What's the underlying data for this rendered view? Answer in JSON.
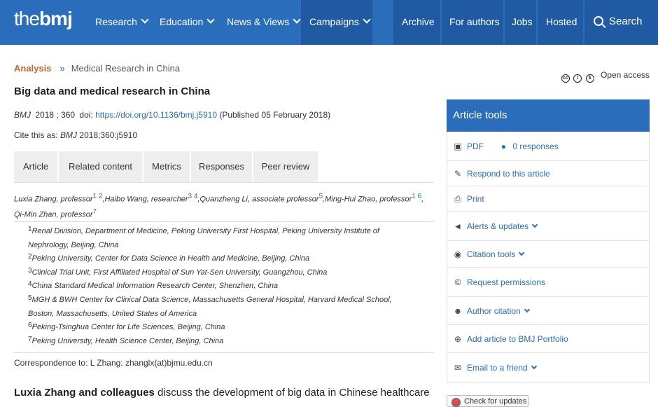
{
  "logo": {
    "the": "the",
    "bmj": "bmj"
  },
  "nav": {
    "research": "Research",
    "education": "Education",
    "news": "News & Views",
    "campaigns": "Campaigns",
    "archive": "Archive",
    "for_authors": "For authors",
    "jobs": "Jobs",
    "hosted": "Hosted",
    "search": "Search"
  },
  "breadcrumb": {
    "section": "Analysis",
    "separator": "»",
    "subsection": "Medical Research in China"
  },
  "open_access": "Open access",
  "article": {
    "title": "Big data and medical research in China",
    "journal": "BMJ",
    "year_vol": "2018 ; 360",
    "doi_label": "doi:",
    "doi": "https://doi.org/10.1136/bmj.j5910",
    "published": "(Published 05 February 2018)",
    "cite_prefix": "Cite this as:",
    "cite_journal": "BMJ",
    "cite_ref": "2018;360:j5910"
  },
  "tabs": [
    "Article",
    "Related content",
    "Metrics",
    "Responses",
    "Peer review"
  ],
  "authors": [
    {
      "name": "Luxia Zhang, professor",
      "sup": "1 2"
    },
    {
      "name": "Haibo Wang, researcher",
      "sup": "3 4"
    },
    {
      "name": "Quanzheng Li, associate professor",
      "sup": "5"
    },
    {
      "name": "Ming-Hui Zhao, professor",
      "sup": "1 6"
    },
    {
      "name": "Qi-Min Zhan, professor",
      "sup": "7"
    }
  ],
  "affiliations": [
    {
      "num": "1",
      "text": "Renal Division, Department of Medicine, Peking University First Hospital, Peking University Institute of Nephrology, Beijing, China"
    },
    {
      "num": "2",
      "text": "Peking University, Center for Data Science in Health and Medicine, Beijing, China"
    },
    {
      "num": "3",
      "text": "Clinical Trial Unit, First Affiliated Hospital of Sun Yat-Sen University, Guangzhou, China"
    },
    {
      "num": "4",
      "text": "China Standard Medical Information Research Center, Shenzhen, China"
    },
    {
      "num": "5",
      "text": "MGH & BWH Center for Clinical Data Science, Massachusetts General Hospital, Harvard Medical School, Boston, Massachusetts, United States of America"
    },
    {
      "num": "6",
      "text": "Peking-Tsinghua Center for Life Sciences, Beijing, China"
    },
    {
      "num": "7",
      "text": "Peking University, Health Science Center, Beijing, China"
    }
  ],
  "correspondence": "Correspondence to: L Zhang: zhanglx(at)bjmu.edu.cn",
  "lede": {
    "authors": "Luxia Zhang and colleagues",
    "rest": " discuss the development of big data in Chinese healthcare"
  },
  "tools": {
    "heading": "Article tools",
    "pdf": "PDF",
    "responses": "0 responses",
    "respond": "Respond to this article",
    "print": "Print",
    "alerts": "Alerts & updates",
    "citation_tools": "Citation tools",
    "permissions": "Request permissions",
    "author_citation": "Author citation",
    "portfolio": "Add article to BMJ Portfolio",
    "email": "Email to a friend"
  },
  "check_updates": "Check for updates",
  "colors": {
    "brand_blue": "#2a6ebb",
    "nav_dark": "#1f5aa3",
    "section_orange": "#c6662c"
  }
}
